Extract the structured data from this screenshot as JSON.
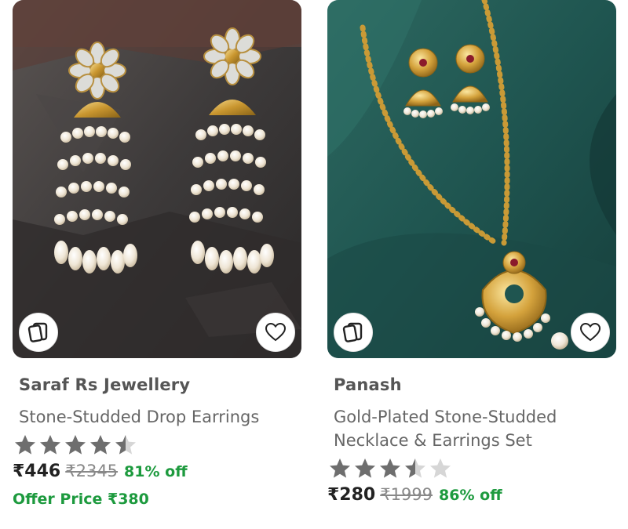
{
  "products": [
    {
      "brand": "Saraf Rs Jewellery",
      "title": "Stone-Studded Drop Earrings",
      "rating": 4.5,
      "price": "₹446",
      "mrp": "₹2345",
      "discount": "81% off",
      "offer_price": "Offer Price ₹380",
      "icons": {
        "similar": "similar-products-icon",
        "wishlist": "heart-icon"
      }
    },
    {
      "brand": "Panash",
      "title_line1": "Gold-Plated Stone-Studded",
      "title_line2": "Necklace & Earrings Set",
      "rating": 3.5,
      "price": "₹280",
      "mrp": "₹1999",
      "discount": "86% off",
      "icons": {
        "similar": "similar-products-icon",
        "wishlist": "heart-icon"
      }
    }
  ],
  "colors": {
    "star_filled": "#6e6e6e",
    "star_empty": "#d6d6d6",
    "discount_green": "#1d9a3e"
  }
}
